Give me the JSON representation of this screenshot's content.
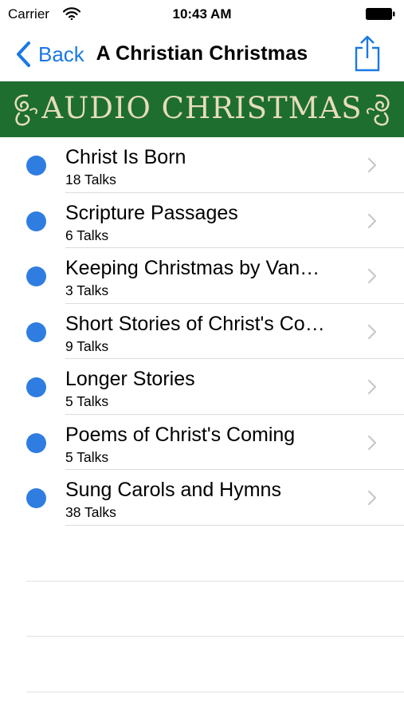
{
  "status_bar": {
    "carrier": "Carrier",
    "time": "10:43 AM"
  },
  "nav": {
    "back_label": "Back",
    "title": "A Christian Christmas"
  },
  "banner": {
    "text": "AUDIO CHRISTMAS"
  },
  "colors": {
    "accent": "#1a78e6",
    "dot": "#2f7de1",
    "banner_bg": "#1e6e30",
    "banner_text": "#e6dcbc"
  },
  "icons": {
    "back": "chevron-left-icon",
    "share": "share-icon",
    "row": "chevron-right-icon"
  },
  "items": [
    {
      "title": "Christ Is Born",
      "subtitle": "18 Talks"
    },
    {
      "title": "Scripture Passages",
      "subtitle": "6 Talks"
    },
    {
      "title": "Keeping Christmas by Van…",
      "subtitle": "3 Talks"
    },
    {
      "title": "Short Stories of Christ's Co…",
      "subtitle": "9 Talks"
    },
    {
      "title": "Longer Stories",
      "subtitle": "5 Talks"
    },
    {
      "title": "Poems of Christ's Coming",
      "subtitle": "5 Talks"
    },
    {
      "title": "Sung Carols and Hymns",
      "subtitle": "38 Talks"
    }
  ]
}
